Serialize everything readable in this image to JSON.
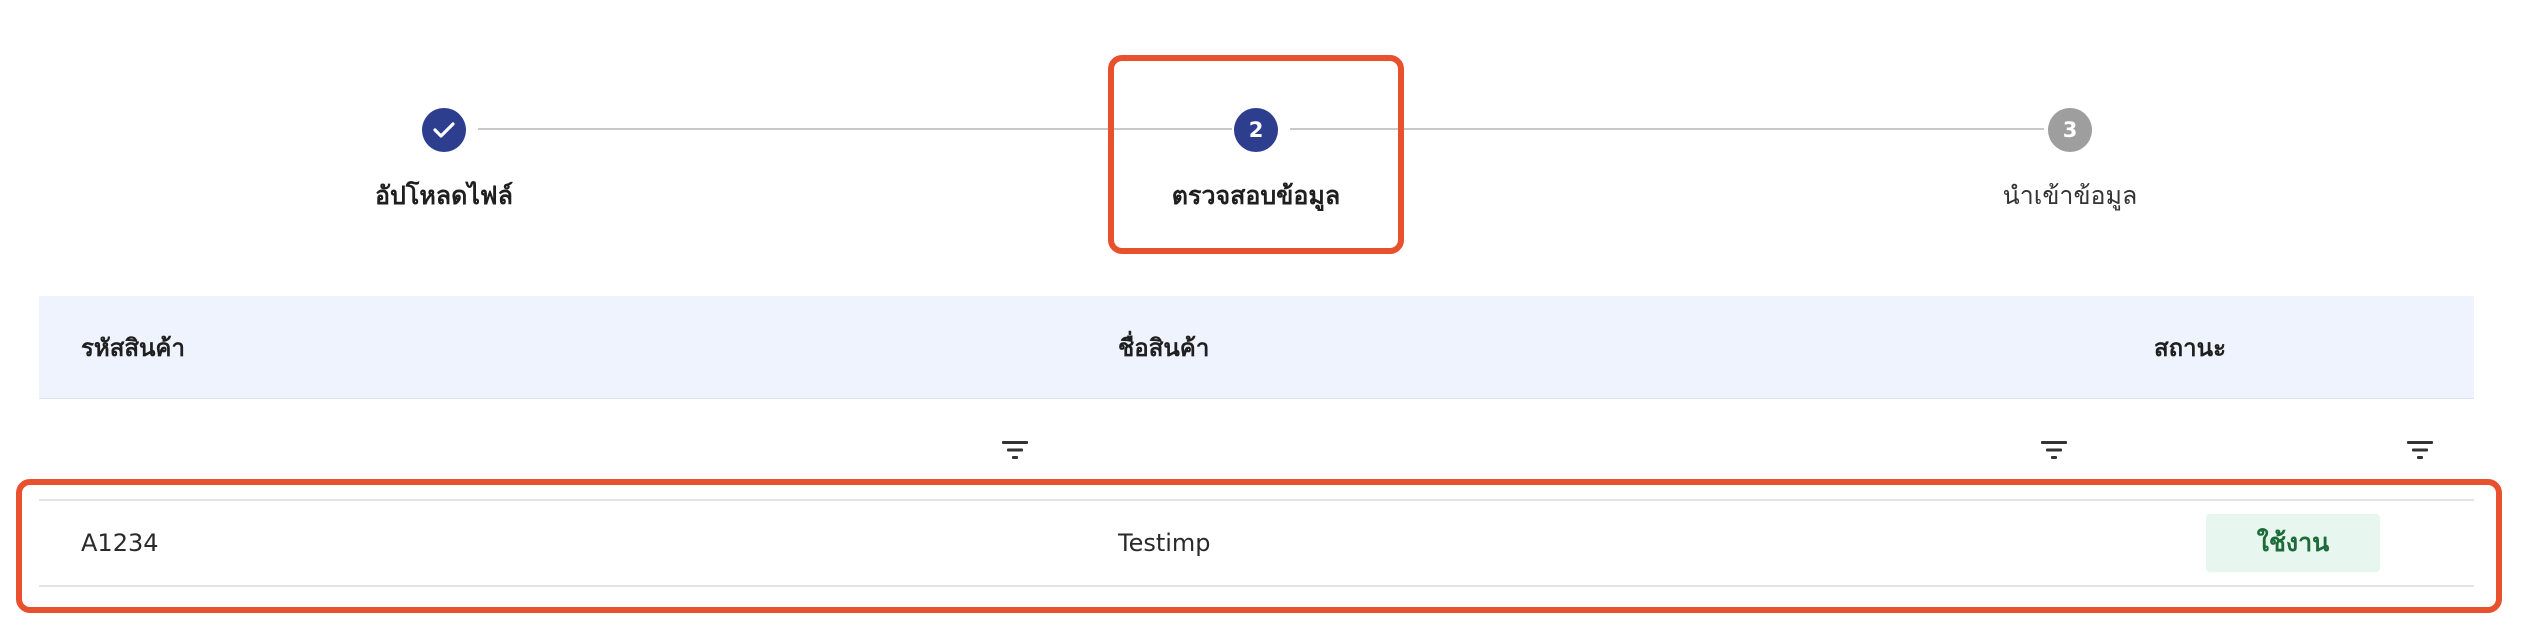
{
  "stepper": {
    "steps": [
      {
        "number": "",
        "label": "อัปโหลดไฟล์",
        "state": "done",
        "icon": "check-icon"
      },
      {
        "number": "2",
        "label": "ตรวจสอบข้อมูล",
        "state": "active"
      },
      {
        "number": "3",
        "label": "นำเข้าข้อมูล",
        "state": "pending"
      }
    ]
  },
  "table": {
    "columns": [
      "รหัสสินค้า",
      "ชื่อสินค้า",
      "สถานะ"
    ],
    "filter_icon": "filter-icon",
    "rows": [
      {
        "code": "A1234",
        "name": "Testimp",
        "status": "ใช้งาน"
      }
    ]
  },
  "colors": {
    "primary": "#2d3e8f",
    "pending": "#9e9e9e",
    "highlight": "#e8502e",
    "header_bg": "#eef3fd",
    "badge_bg": "#e7f6ee",
    "badge_text": "#1e6b3a"
  }
}
